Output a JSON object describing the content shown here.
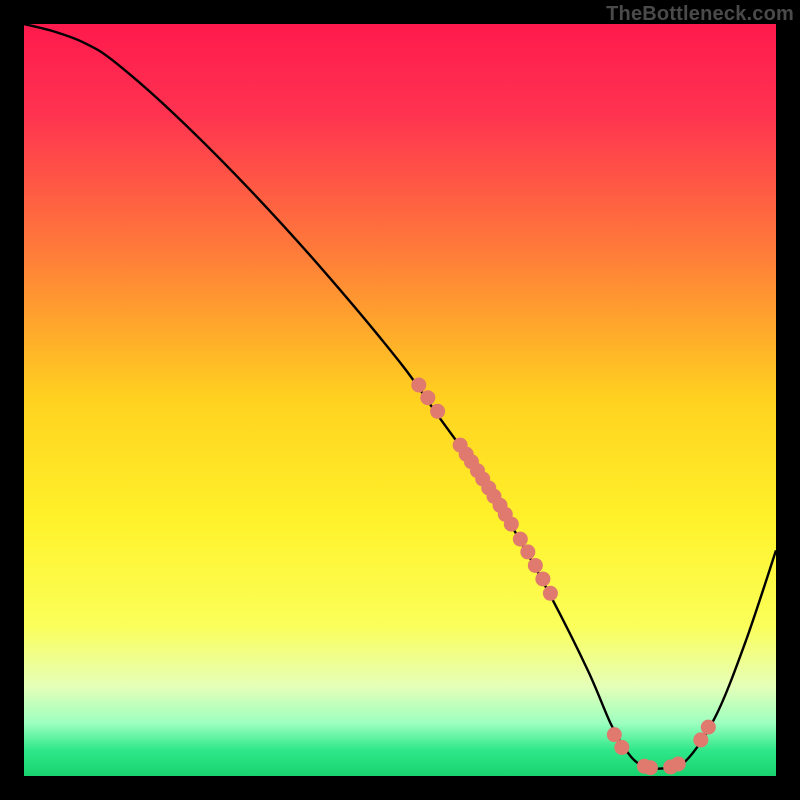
{
  "watermark": "TheBottleneck.com",
  "chart_data": {
    "type": "line",
    "title": "",
    "xlabel": "",
    "ylabel": "",
    "xlim": [
      0,
      100
    ],
    "ylim": [
      0,
      100
    ],
    "curve": {
      "name": "bottleneck-curve",
      "x": [
        0,
        4,
        8,
        12,
        20,
        30,
        40,
        50,
        55,
        60,
        65,
        70,
        75,
        78,
        80,
        82,
        85,
        88,
        92,
        96,
        100
      ],
      "y": [
        100,
        99,
        97.5,
        95,
        88,
        78,
        67,
        55,
        48,
        41,
        33,
        24,
        14,
        7,
        3.5,
        1.5,
        1.0,
        2.0,
        8,
        18,
        30
      ]
    },
    "scatter": {
      "name": "observed-points",
      "points": [
        {
          "x": 52.5,
          "y": 52.0
        },
        {
          "x": 53.7,
          "y": 50.3
        },
        {
          "x": 55.0,
          "y": 48.5
        },
        {
          "x": 58.0,
          "y": 44.0
        },
        {
          "x": 58.8,
          "y": 42.8
        },
        {
          "x": 59.5,
          "y": 41.8
        },
        {
          "x": 60.3,
          "y": 40.6
        },
        {
          "x": 61.0,
          "y": 39.5
        },
        {
          "x": 61.8,
          "y": 38.3
        },
        {
          "x": 62.5,
          "y": 37.2
        },
        {
          "x": 63.3,
          "y": 36.0
        },
        {
          "x": 64.0,
          "y": 34.8
        },
        {
          "x": 64.8,
          "y": 33.5
        },
        {
          "x": 66.0,
          "y": 31.5
        },
        {
          "x": 67.0,
          "y": 29.8
        },
        {
          "x": 68.0,
          "y": 28.0
        },
        {
          "x": 69.0,
          "y": 26.2
        },
        {
          "x": 70.0,
          "y": 24.3
        },
        {
          "x": 78.5,
          "y": 5.5
        },
        {
          "x": 79.5,
          "y": 3.8
        },
        {
          "x": 82.5,
          "y": 1.3
        },
        {
          "x": 83.3,
          "y": 1.1
        },
        {
          "x": 86.0,
          "y": 1.2
        },
        {
          "x": 87.0,
          "y": 1.6
        },
        {
          "x": 90.0,
          "y": 4.8
        },
        {
          "x": 91.0,
          "y": 6.5
        }
      ]
    },
    "gradient_stops": [
      {
        "offset": 0.0,
        "color": "#ff1a4d"
      },
      {
        "offset": 0.12,
        "color": "#ff3350"
      },
      {
        "offset": 0.3,
        "color": "#ff7a3a"
      },
      {
        "offset": 0.5,
        "color": "#ffd21f"
      },
      {
        "offset": 0.66,
        "color": "#fff22a"
      },
      {
        "offset": 0.8,
        "color": "#fbff5a"
      },
      {
        "offset": 0.88,
        "color": "#e6ffb8"
      },
      {
        "offset": 0.93,
        "color": "#9cffc0"
      },
      {
        "offset": 0.965,
        "color": "#30e88a"
      },
      {
        "offset": 1.0,
        "color": "#17d36f"
      }
    ],
    "point_color": "#e0796e",
    "curve_color": "#000000"
  }
}
